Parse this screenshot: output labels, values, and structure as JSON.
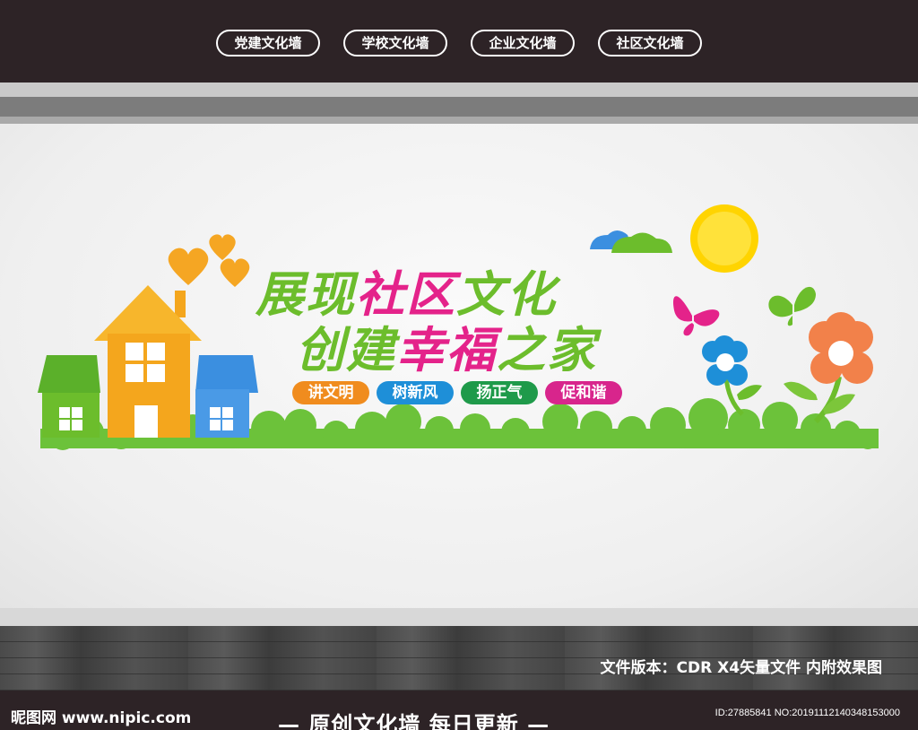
{
  "nav": {
    "items": [
      {
        "label": "党建文化墙"
      },
      {
        "label": "学校文化墙"
      },
      {
        "label": "企业文化墙"
      },
      {
        "label": "社区文化墙"
      }
    ]
  },
  "mural": {
    "title_line1": {
      "part1": "展现",
      "part2": "社区",
      "part3": "文化"
    },
    "title_line2": {
      "part1": "创建",
      "part2": "幸福",
      "part3": "之家"
    },
    "tags": [
      {
        "label": "讲文明",
        "color": "#f08c1e"
      },
      {
        "label": "树新风",
        "color": "#1e8fd8"
      },
      {
        "label": "扬正气",
        "color": "#1f9a4a"
      },
      {
        "label": "促和谐",
        "color": "#d8258c"
      }
    ],
    "colors": {
      "green": "#6cbd2c",
      "pink": "#e4238a",
      "orange": "#f4a61d",
      "blue": "#3b8fe0",
      "sun": "#ffd400"
    }
  },
  "footer": {
    "version": "文件版本：CDR X4矢量文件 内附效果图",
    "brand": "昵图网 www.nipic.com",
    "slogan": "— 原创文化墙 每日更新 —",
    "id": "ID:27885841 NO:20191112140348153000"
  }
}
